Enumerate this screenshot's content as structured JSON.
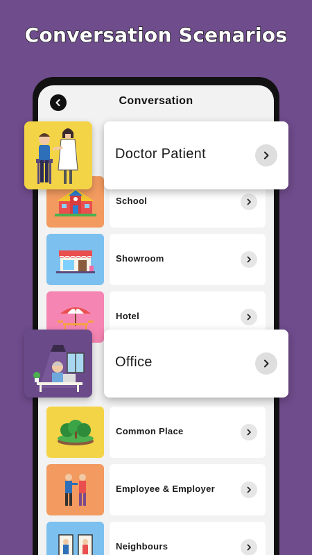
{
  "headline": "Conversation Scenarios",
  "screen": {
    "title": "Conversation"
  },
  "rows": [
    {
      "label": "School",
      "color": "#f29a5f"
    },
    {
      "label": "Showroom",
      "color": "#7cc0f0"
    },
    {
      "label": "Hotel",
      "color": "#f585b3"
    },
    {
      "label": "Common Place",
      "color": "#f4d447"
    },
    {
      "label": "Employee & Employer",
      "color": "#f29a5f"
    },
    {
      "label": "Neighbours",
      "color": "#7cc0f0"
    }
  ],
  "featured": [
    {
      "label": "Doctor Patient",
      "color": "#f4d447"
    },
    {
      "label": "Office",
      "color": "#6b4a8a"
    }
  ],
  "icons": {
    "back": "back-arrow-icon",
    "chevron": "chevron-right-icon"
  }
}
